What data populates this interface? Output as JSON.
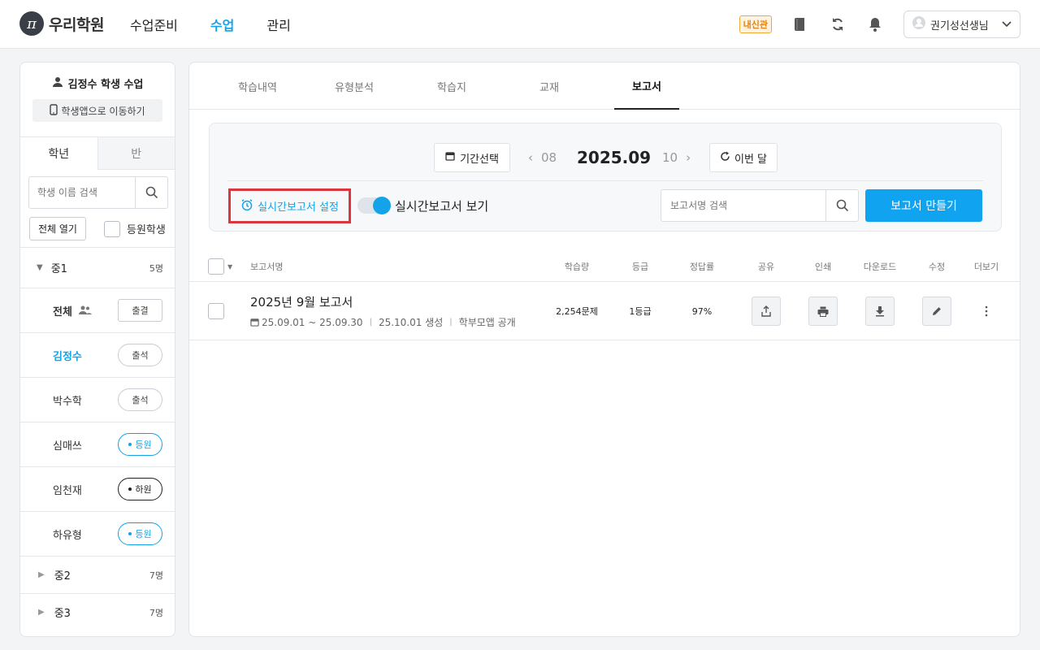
{
  "header": {
    "logo_mark": "π",
    "logo_text": "우리학원",
    "nav": [
      "수업준비",
      "수업",
      "관리"
    ],
    "active_nav": 1,
    "badge": "내신관",
    "user": "권기성선생님"
  },
  "sidebar": {
    "title": "김정수 학생 수업",
    "app_button": "학생앱으로 이동하기",
    "tabs": [
      "학년",
      "반"
    ],
    "search_placeholder": "학생 이름 검색",
    "open_all": "전체 열기",
    "attending_label": "등원학생",
    "group1": {
      "name": "중1",
      "count": "5명"
    },
    "all_label": "전체",
    "all_button": "출결",
    "students": [
      {
        "name": "김정수",
        "status": "출석"
      },
      {
        "name": "박수학",
        "status": "출석"
      },
      {
        "name": "심매쓰",
        "status": "등원"
      },
      {
        "name": "임천재",
        "status": "하원"
      },
      {
        "name": "하유형",
        "status": "등원"
      }
    ],
    "group2": {
      "name": "중2",
      "count": "7명"
    },
    "group3": {
      "name": "중3",
      "count": "7명"
    }
  },
  "main": {
    "tabs": [
      "학습내역",
      "유형분석",
      "학습지",
      "교재",
      "보고서"
    ],
    "active_tab": 4,
    "period_button": "기간선택",
    "prev_month": "08",
    "current_month": "2025.09",
    "next_month": "10",
    "this_month_button": "이번 달",
    "realtime_setting": "실시간보고서 설정",
    "realtime_view": "실시간보고서 보기",
    "realtime_view_on": true,
    "report_search_placeholder": "보고서명 검색",
    "create_button": "보고서 만들기",
    "columns": {
      "name": "보고서명",
      "amount": "학습량",
      "grade": "등급",
      "rate": "정답률",
      "share": "공유",
      "print": "인쇄",
      "download": "다운로드",
      "edit": "수정",
      "more": "더보기"
    },
    "rows": [
      {
        "title": "2025년 9월 보고서",
        "period": "25.09.01 ~ 25.09.30",
        "created": "25.10.01 생성",
        "visibility": "학부모앱 공개",
        "amount": "2,254문제",
        "grade": "1등급",
        "rate": "97%"
      }
    ]
  },
  "colors": {
    "accent": "#14a3e8",
    "highlight_border": "#d9363e",
    "badge_orange": "#e0821a"
  }
}
